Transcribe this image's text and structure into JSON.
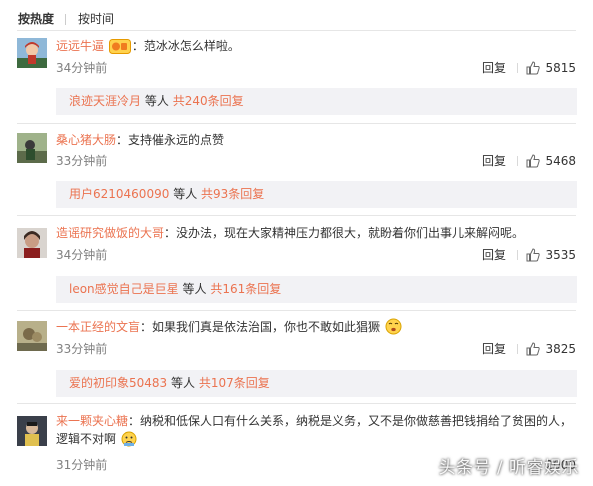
{
  "sort": {
    "hot": "按热度",
    "time": "按时间"
  },
  "reply_label": "回复",
  "more_suffix": "等人",
  "comments": [
    {
      "user": "远远牛逼",
      "text": "：范冰冰怎么样啦。",
      "time": "34分钟前",
      "likes": "5815",
      "replies": {
        "user": "浪迹天涯冷月",
        "suffix": "等人",
        "count": "共240条回复"
      }
    },
    {
      "user": "桑心猪大肠",
      "text": "：支持催永远的点赞",
      "time": "33分钟前",
      "likes": "5468",
      "replies": {
        "user": "用户6210460090",
        "suffix": "等人",
        "count": "共93条回复"
      }
    },
    {
      "user": "造谣研究做饭的大哥",
      "text": "：没办法，现在大家精神压力都很大，就盼着你们出事儿来解闷呢。",
      "time": "34分钟前",
      "likes": "3535",
      "replies": {
        "user": "leon感觉自己是巨星",
        "suffix": "等人",
        "count": "共161条回复"
      }
    },
    {
      "user": "一本正经的文盲",
      "text": "：如果我们真是依法治国，你也不敢如此猖獗",
      "time": "33分钟前",
      "likes": "3825",
      "replies": {
        "user": "爱的初印象50483",
        "suffix": "等人",
        "count": "共107条回复"
      }
    },
    {
      "user": "来一颗夹心糖",
      "text": "：纳税和低保人口有什么关系，纳税是义务，又不是你做慈善把钱捐给了贫困的人，逻辑不对啊",
      "time": "31分钟前",
      "likes": "2000"
    }
  ],
  "watermark": "头条号 / 听睿娱乐",
  "colors": {
    "username": "#eb7350",
    "reply_bg": "#f2f2f5",
    "meta": "#808080"
  }
}
